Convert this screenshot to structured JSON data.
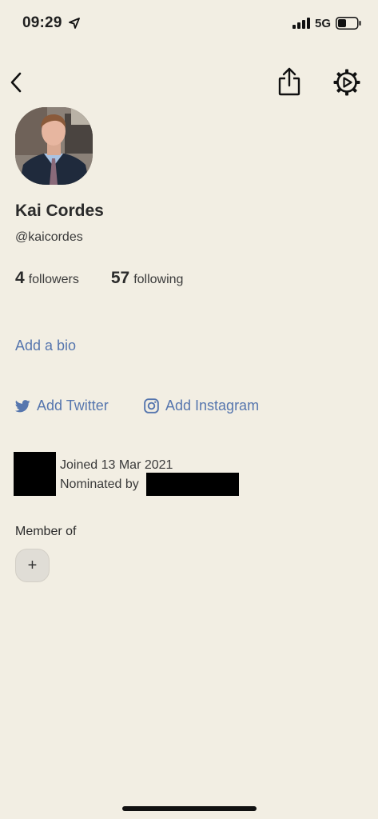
{
  "status_bar": {
    "time": "09:29",
    "network": "5G",
    "icons": [
      "location-arrow-icon",
      "signal-bars-icon",
      "battery-icon"
    ]
  },
  "header": {
    "icons": [
      "back-chevron-icon",
      "share-icon",
      "settings-gear-icon"
    ]
  },
  "profile": {
    "name": "Kai Cordes",
    "handle": "@kaicordes",
    "followers_count": "4",
    "followers_label": "followers",
    "following_count": "57",
    "following_label": "following",
    "add_bio": "Add a bio",
    "add_twitter": "Add Twitter",
    "add_instagram": "Add Instagram",
    "joined": "Joined 13 Mar 2021",
    "nominated_by": "Nominated by"
  },
  "clubs": {
    "title": "Member of",
    "add_label": "+"
  },
  "colors": {
    "background": "#f2eee3",
    "link": "#5676ae",
    "text": "#2b2b2b"
  }
}
